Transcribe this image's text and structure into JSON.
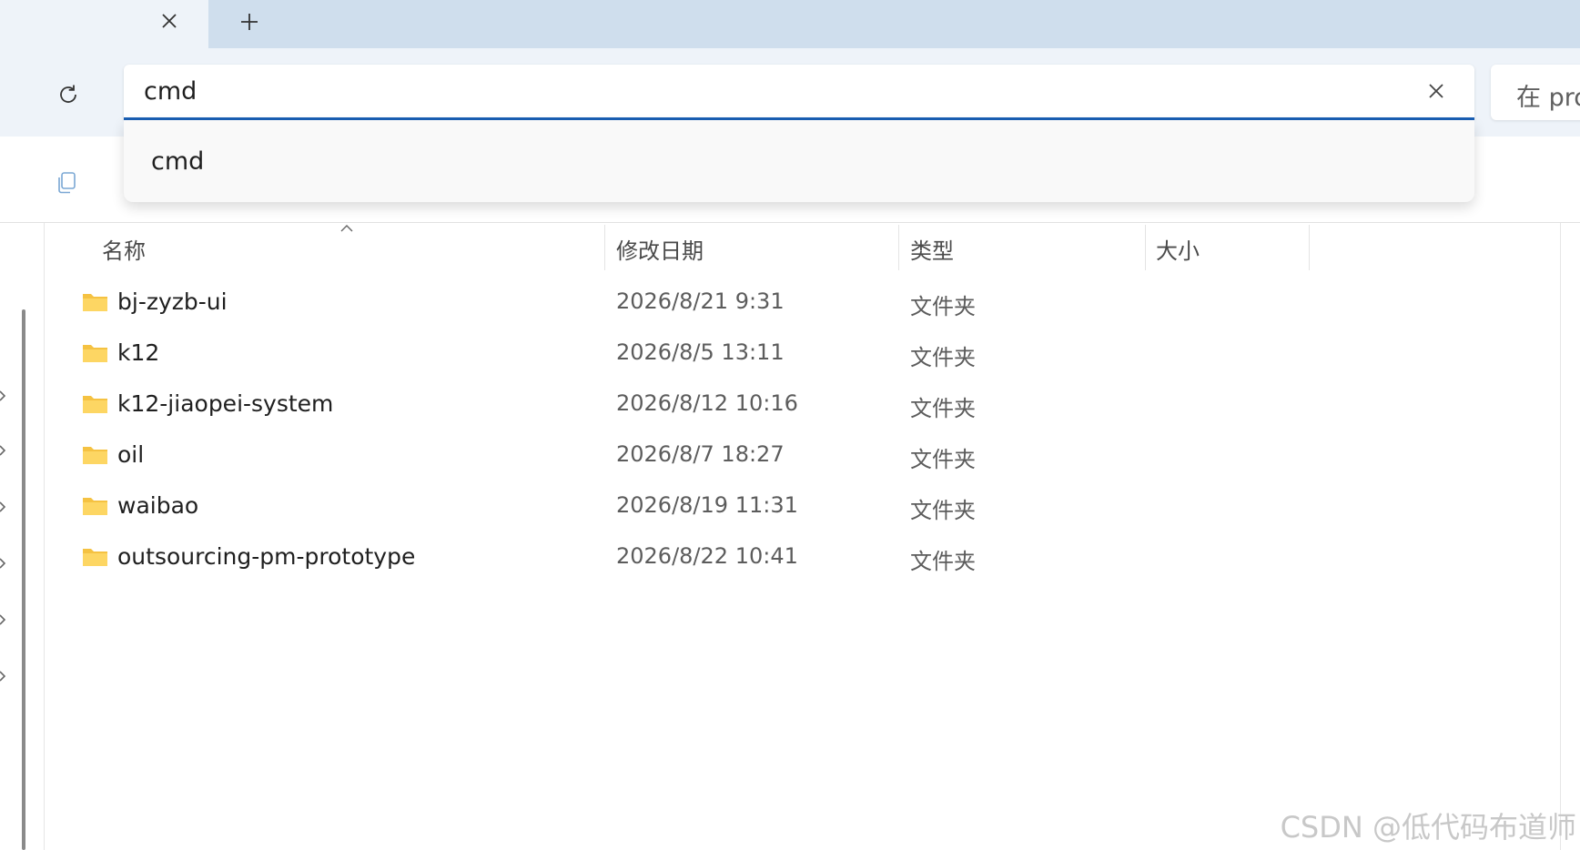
{
  "tab": {
    "close_icon": "close-icon",
    "new_tab_icon": "plus-icon"
  },
  "nav": {
    "refresh_icon": "refresh-icon"
  },
  "search": {
    "value": "cmd",
    "clear_icon": "close-icon"
  },
  "right_search": {
    "text": "在 pro"
  },
  "suggestions": [
    {
      "label": "cmd"
    }
  ],
  "command_bar": {
    "copy_icon": "copy-icon"
  },
  "columns": {
    "name": "名称",
    "modified": "修改日期",
    "type": "类型",
    "size": "大小"
  },
  "files": [
    {
      "name": "bj-zyzb-ui",
      "modified": "2026/8/21 9:31",
      "type": "文件夹"
    },
    {
      "name": "k12",
      "modified": "2026/8/5 13:11",
      "type": "文件夹"
    },
    {
      "name": "k12-jiaopei-system",
      "modified": "2026/8/12 10:16",
      "type": "文件夹"
    },
    {
      "name": "oil",
      "modified": "2026/8/7 18:27",
      "type": "文件夹"
    },
    {
      "name": "waibao",
      "modified": "2026/8/19 11:31",
      "type": "文件夹"
    },
    {
      "name": "outsourcing-pm-prototype",
      "modified": "2026/8/22 10:41",
      "type": "文件夹"
    }
  ],
  "watermark": "CSDN @低代码布道师",
  "colors": {
    "accent": "#1a5fb4",
    "tabstrip": "#cfdeed",
    "folder": "#f5c242"
  }
}
